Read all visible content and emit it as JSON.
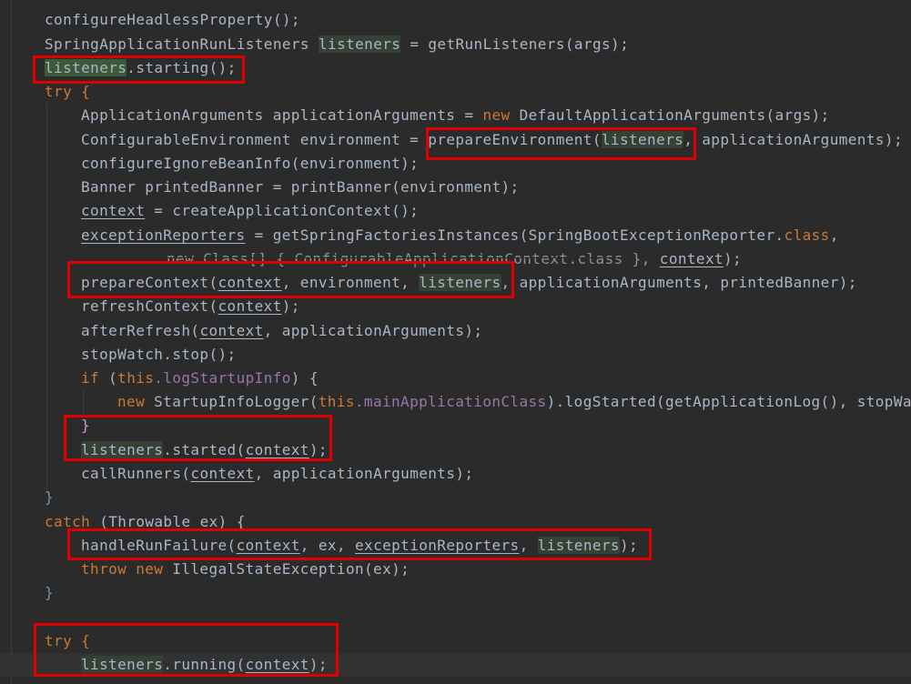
{
  "code": {
    "l0": "configureHeadlessProperty();",
    "l1a": "SpringApplicationRunListeners",
    "l1b": "listeners",
    "l1c": " = getRunListeners(args);",
    "l2a": "listeners",
    "l2b": ".starting();",
    "l3": "try {",
    "l4a": "ApplicationArguments applicationArguments = ",
    "l4kw": "new",
    "l4b": " DefaultApplicationArguments(args);",
    "l5a": "ConfigurableEnvironment environment = ",
    "l5fn": "prepareEnvironment",
    "l5var": "listeners",
    "l5b": ", applicationArguments);",
    "l6": "configureIgnoreBeanInfo(environment);",
    "l7": "Banner printedBanner = printBanner(environment);",
    "l8a": "context",
    "l8b": " = createApplicationContext();",
    "l9a": "exceptionReporters",
    "l9b": " = getSpringFactoriesInstances(SpringBootExceptionReporter.",
    "l9kw": "class",
    "l9c": ",",
    "l10a": "new Class[] { ConfigurableApplicationContext.class }, ",
    "l10var": "context",
    "l10b": ");",
    "l11a": "prepareContext(",
    "l11ctx": "context",
    "l11b": ", environment, ",
    "l11lst": "listeners",
    "l11c": ", applicationArguments, printedBanner);",
    "l12a": "refreshContext(",
    "l12ctx": "context",
    "l12b": ");",
    "l13a": "afterRefresh(",
    "l13ctx": "context",
    "l13b": ", applicationArguments);",
    "l14": "stopWatch.stop();",
    "l15kw": "if",
    "l15a": " (",
    "l15this": "this",
    "l15field": ".logStartupInfo",
    "l15b": ") {",
    "l16kw": "new",
    "l16a": " StartupInfoLogger(",
    "l16this": "this",
    "l16field": ".mainApplicationClass",
    "l16b": ").logStarted(getApplicationLog(), stopWa",
    "l17": "}",
    "l18a": "listeners",
    "l18b": ".started(",
    "l18ctx": "context",
    "l18c": ");",
    "l19a": "callRunners(",
    "l19ctx": "context",
    "l19b": ", applicationArguments);",
    "l20": "}",
    "l21kw": "catch",
    "l21a": " (Throwable ex) {",
    "l22a": "handleRunFailure(",
    "l22ctx": "context",
    "l22b": ", ex, ",
    "l22rep": "exceptionReporters",
    "l22c": ", ",
    "l22lst": "listeners",
    "l22d": ");",
    "l23kw": "throw new",
    "l23a": " IllegalStateException(ex);",
    "l24": "}",
    "l26": "try {",
    "l27a": "listeners",
    "l27b": ".running(",
    "l27ctx": "context",
    "l27c": ");"
  },
  "colors": {
    "background": "#2b2b2b",
    "keyword": "#cc7832",
    "function": "#ffc66d",
    "field": "#9876aa",
    "annotation_box": "#e00000"
  }
}
